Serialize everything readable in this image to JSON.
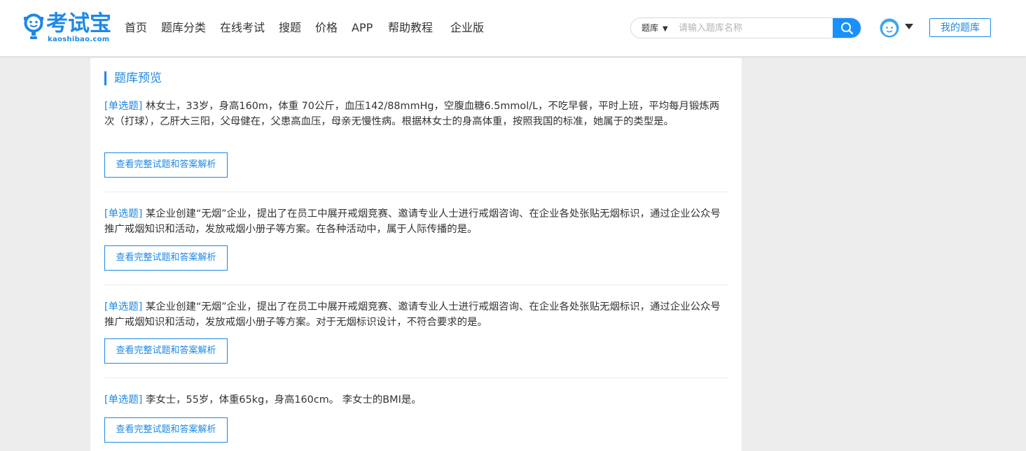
{
  "header": {
    "logo": {
      "text": "考试宝",
      "sub": "kaoshibao.com"
    },
    "nav": [
      "首页",
      "题库分类",
      "在线考试",
      "搜题",
      "价格",
      "APP",
      "帮助教程",
      "企业版"
    ],
    "search": {
      "category": "题库",
      "placeholder": "请输入题库名称",
      "value": ""
    },
    "my_bank_label": "我的题库"
  },
  "main": {
    "section_title": "题库预览",
    "questions": [
      {
        "type": "[单选题]",
        "text": "林女士，33岁，身高160m，体重 70公斤，血压142/88mmHg，空腹血糖6.5mmol/L，不吃早餐，平时上班，平均每月锻炼两次（打球），乙肝大三阳，父母健在，父患高血压，母亲无慢性病。根据林女士的身高体重，按照我国的标准，她属于的类型是。",
        "button": "查看完整试题和答案解析"
      },
      {
        "type": "[单选题]",
        "text": "某企业创建“无烟”企业，提出了在员工中展开戒烟竞赛、邀请专业人士进行戒烟咨询、在企业各处张贴无烟标识，通过企业公众号推广戒烟知识和活动，发放戒烟小册子等方案。在各种活动中，属于人际传播的是。",
        "button": "查看完整试题和答案解析"
      },
      {
        "type": "[单选题]",
        "text": "某企业创建“无烟”企业，提出了在员工中展开戒烟竞赛、邀请专业人士进行戒烟咨询、在企业各处张贴无烟标识，通过企业公众号推广戒烟知识和活动，发放戒烟小册子等方案。对于无烟标识设计，不符合要求的是。",
        "button": "查看完整试题和答案解析"
      },
      {
        "type": "[单选题]",
        "text": "李女士，55岁，体重65kg，身高160cm。 李女士的BMI是。",
        "button": "查看完整试题和答案解析"
      }
    ]
  },
  "colors": {
    "accent": "#1e88e5",
    "search_button": "#1890ff",
    "page_bg": "#ededed"
  },
  "icons": {
    "logo": "bulb-person-icon",
    "search": "magnifier-icon",
    "avatar": "smiley-avatar-icon",
    "dropdown": "caret-down-icon"
  }
}
